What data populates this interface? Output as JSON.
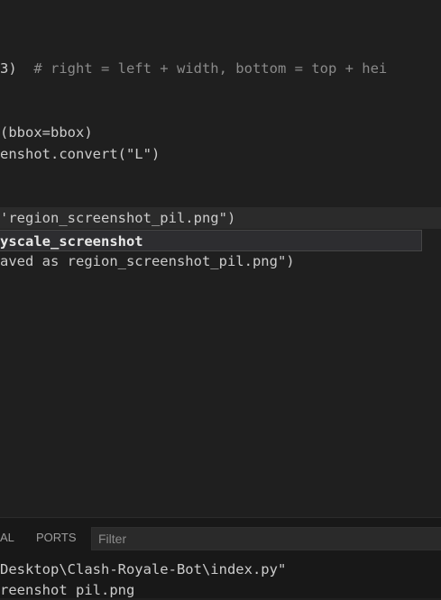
{
  "editor": {
    "line1_code": "3)  ",
    "line1_comment": "# right = left + width, bottom = top + hei",
    "line2": "(bbox=bbox)",
    "line3": "enshot.convert(\"L\")",
    "line4": "'region_screenshot_pil.png\")",
    "suggestion": "yscale_screenshot",
    "line5": "aved as region_screenshot_pil.png\")"
  },
  "panel": {
    "tab_terminal": "AL",
    "tab_ports": "PORTS",
    "filter_placeholder": "Filter"
  },
  "terminal": {
    "line1": "Desktop\\Clash-Royale-Bot\\index.py\"",
    "line2": "reenshot pil.png"
  }
}
